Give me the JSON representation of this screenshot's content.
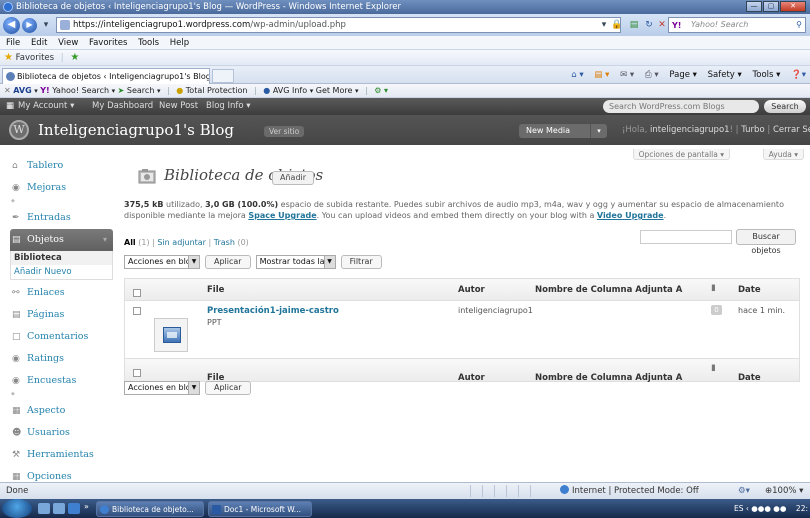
{
  "window": {
    "title": "Biblioteca de objetos ‹ Inteligenciagrupo1's Blog — WordPress - Windows Internet Explorer",
    "buttons": {
      "minimize": "—",
      "maximize": "▢",
      "close": "✕"
    }
  },
  "address": {
    "url_host": "https://inteligenciagrupo1.wordpress.com",
    "url_path": "/wp-admin/upload.php",
    "search_placeholder": "Yahoo! Search"
  },
  "menu": [
    "File",
    "Edit",
    "View",
    "Favorites",
    "Tools",
    "Help"
  ],
  "favorites": {
    "label": "Favorites"
  },
  "tab": {
    "title": "Biblioteca de objetos ‹ Inteligenciagrupo1's Blog ..."
  },
  "command_bar": {
    "page": "Page ▾",
    "safety": "Safety ▾",
    "tools": "Tools ▾"
  },
  "avg_toolbar": {
    "brand": "AVG",
    "yahoo": "Yahoo! Search",
    "search": "Search",
    "total_protection": "Total Protection",
    "avg_info": "AVG Info",
    "get_more": "Get More"
  },
  "wp_bar": {
    "my_account": "My Account",
    "my_dashboard": "My Dashboard",
    "new_post": "New Post",
    "blog_info": "Blog Info",
    "search_placeholder": "Search WordPress.com Blogs",
    "search_button": "Search"
  },
  "wp_header": {
    "blog_title": "Inteligenciagrupo1's Blog",
    "view_site": "Ver sitio",
    "new_media": "New Media",
    "greeting": "¡Hola,",
    "username": "inteligenciagrupo1",
    "greeting_end": "!",
    "turbo": "Turbo",
    "logout": "Cerrar Sesión"
  },
  "screen_options": "Opciones de pantalla ▾",
  "help": "Ayuda ▾",
  "sidebar": {
    "items": [
      {
        "label": "Tablero",
        "icon": "house-icon"
      },
      {
        "label": "Mejoras",
        "icon": "upgrade-icon"
      },
      {
        "label": "Entradas",
        "icon": "pushpin-icon"
      },
      {
        "label": "Objetos",
        "icon": "media-icon"
      },
      {
        "label": "Enlaces",
        "icon": "link-icon"
      },
      {
        "label": "Páginas",
        "icon": "page-icon"
      },
      {
        "label": "Comentarios",
        "icon": "comment-icon"
      },
      {
        "label": "Ratings",
        "icon": "ratings-icon"
      },
      {
        "label": "Encuestas",
        "icon": "polls-icon"
      },
      {
        "label": "Aspecto",
        "icon": "appearance-icon"
      },
      {
        "label": "Usuarios",
        "icon": "users-icon"
      },
      {
        "label": "Herramientas",
        "icon": "tools-icon"
      },
      {
        "label": "Opciones",
        "icon": "settings-icon"
      }
    ],
    "submenu": [
      "Biblioteca",
      "Añadir Nuevo"
    ]
  },
  "main": {
    "title": "Biblioteca de objetos",
    "add_new": "Añadir",
    "storage_used": "375,5 kB",
    "storage_text_1": " utilizado, ",
    "storage_total": "3,0 GB (100.0%)",
    "storage_text_2": " espacio de subida restante. Puedes subir archivos de audio mp3, m4a, wav y ogg y aumentar su espacio de almacenamiento disponible mediante la mejora ",
    "space_upgrade": "Space Upgrade",
    "storage_text_3": ". You can upload videos and embed them directly on your blog with a ",
    "video_upgrade": "Video Upgrade",
    "storage_text_4": ".",
    "filters": {
      "all": "All",
      "all_count": "(1)",
      "sep": "|",
      "unattached": "Sin adjuntar",
      "trash": "Trash",
      "trash_count": "(0)"
    },
    "search_button": "Buscar objetos",
    "bulk_actions": "Acciones en bloq",
    "apply": "Aplicar",
    "show_all": "Mostrar todas la",
    "filter": "Filtrar",
    "columns": {
      "file": "File",
      "author": "Autor",
      "attached": "Nombre de Columna Adjunta A",
      "date": "Date"
    },
    "rows": [
      {
        "title": "Presentación1-jaime-castro",
        "type": "PPT",
        "author": "inteligenciagrupo1",
        "comments": "0",
        "date": "hace 1 min."
      }
    ]
  },
  "status": {
    "text": "Done",
    "zone": "Internet | Protected Mode: Off",
    "zoom": "100%"
  },
  "taskbar": {
    "tasks": [
      "Biblioteca de objeto...",
      "Doc1 - Microsoft W..."
    ],
    "time": "22:"
  }
}
